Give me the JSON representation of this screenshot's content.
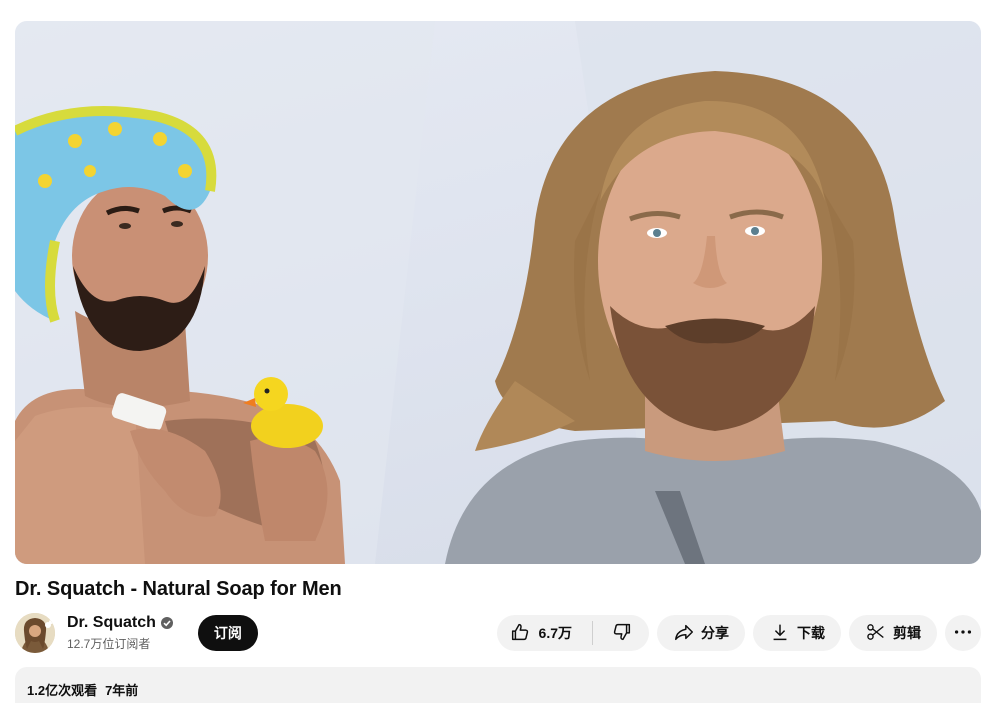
{
  "video": {
    "title": "Dr. Squatch - Natural Soap for Men"
  },
  "channel": {
    "name": "Dr. Squatch",
    "subscribers": "12.7万位订阅者",
    "subscribe_label": "订阅"
  },
  "actions": {
    "like_count": "6.7万",
    "share_label": "分享",
    "download_label": "下载",
    "clip_label": "剪辑"
  },
  "description": {
    "views": "1.2亿次观看",
    "age": "7年前"
  },
  "icons": {
    "verified": "verified-check-icon",
    "like": "thumb-up-icon",
    "dislike": "thumb-down-icon",
    "share": "share-arrow-icon",
    "download": "download-icon",
    "clip": "scissors-icon",
    "more": "more-horizontal-icon"
  },
  "colors": {
    "subscribe_bg": "#0f0f0f",
    "pill_bg": "#f2f2f2",
    "secondary_text": "#606060"
  }
}
